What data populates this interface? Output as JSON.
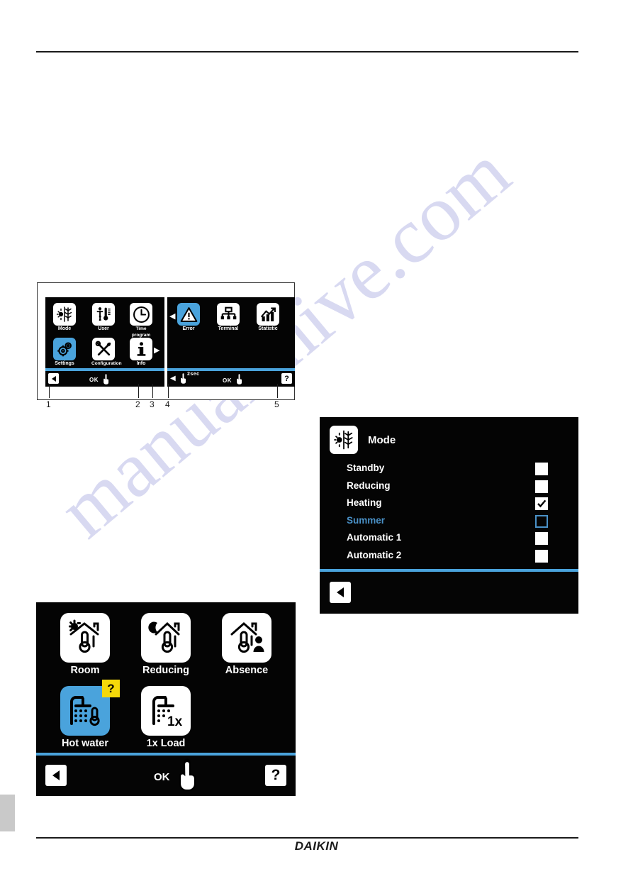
{
  "page": {
    "brand": "DAIKIN"
  },
  "watermark": {
    "text": "manualshive.com"
  },
  "figure_menu": {
    "screen_left": {
      "tiles": [
        {
          "label": "Mode",
          "icon": "sun-snowflake-icon",
          "selected": false
        },
        {
          "label": "User",
          "icon": "user-thermometer-icon",
          "selected": false
        },
        {
          "label": "Time program",
          "icon": "clock-icon",
          "selected": false
        },
        {
          "label": "Settings",
          "icon": "gears-icon",
          "selected": true
        },
        {
          "label": "Configuration",
          "icon": "tools-icon",
          "selected": false
        },
        {
          "label": "Info",
          "icon": "info-icon",
          "selected": false
        }
      ],
      "next_arrow": "chevron-right-icon",
      "bottom_bar": {
        "back": "back-arrow-icon",
        "ok_label": "OK",
        "hand": "hand-tap-icon"
      }
    },
    "screen_right": {
      "prev_arrow": "chevron-left-icon",
      "tiles": [
        {
          "label": "Error",
          "icon": "warning-triangle-icon",
          "selected": true
        },
        {
          "label": "Terminal",
          "icon": "terminal-tree-icon",
          "selected": false
        },
        {
          "label": "Statistic",
          "icon": "bar-chart-icon",
          "selected": false
        }
      ],
      "bottom_bar": {
        "back": "back-arrow-icon",
        "hold_label": "2sec",
        "ok_label": "OK",
        "hand": "hand-tap-icon",
        "help_label": "?"
      }
    },
    "callouts": [
      "1",
      "2",
      "3",
      "4",
      "5"
    ]
  },
  "figure_mode": {
    "header": {
      "title": "Mode",
      "icon": "sun-snowflake-icon"
    },
    "options": [
      {
        "label": "Standby",
        "checked": false,
        "active": false
      },
      {
        "label": "Reducing",
        "checked": false,
        "active": false
      },
      {
        "label": "Heating",
        "checked": true,
        "active": false
      },
      {
        "label": "Summer",
        "checked": false,
        "active": true
      },
      {
        "label": "Automatic 1",
        "checked": false,
        "active": false
      },
      {
        "label": "Automatic 2",
        "checked": false,
        "active": false
      }
    ],
    "next_arrow": "chevron-right-icon",
    "bottom_bar": {
      "back": "back-arrow-icon"
    }
  },
  "figure_operating": {
    "tiles": [
      {
        "label": "Room",
        "icon": "sun-house-thermometer-icon",
        "selected": false,
        "badge": null
      },
      {
        "label": "Reducing",
        "icon": "moon-house-thermometer-icon",
        "selected": false,
        "badge": null
      },
      {
        "label": "Absence",
        "icon": "house-person-thermometer-icon",
        "selected": false,
        "badge": null
      },
      {
        "label": "Hot water",
        "icon": "shower-thermometer-icon",
        "selected": true,
        "badge": "?"
      },
      {
        "label": "1x Load",
        "icon": "shower-1x-icon",
        "selected": false,
        "badge": null
      }
    ],
    "bottom_bar": {
      "back": "back-arrow-icon",
      "ok_label": "OK",
      "hand": "hand-tap-icon",
      "help_label": "?"
    }
  },
  "colors": {
    "accent_blue": "#4aa3dc",
    "active_text_blue": "#4a91c7",
    "badge_yellow": "#f5d90a",
    "screen_black": "#040404",
    "watermark": "#b9bbe6"
  }
}
